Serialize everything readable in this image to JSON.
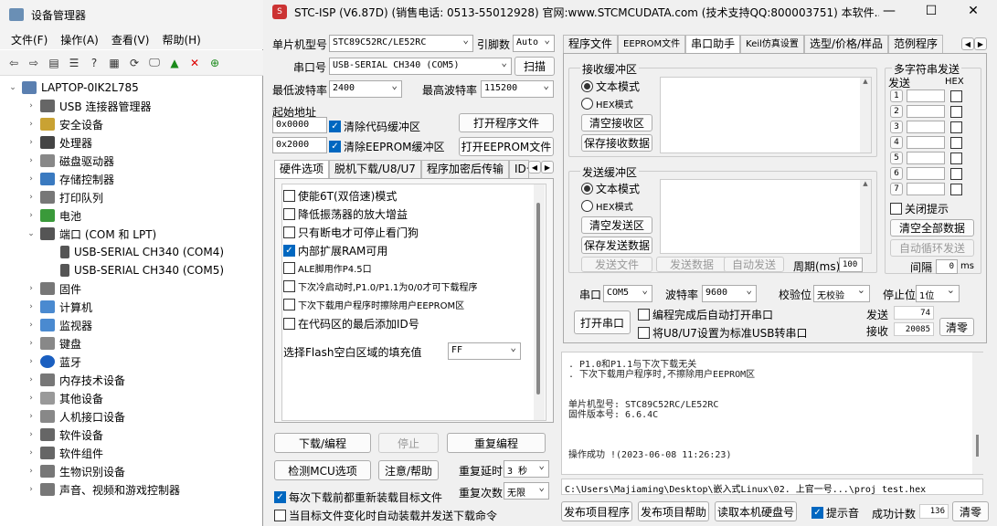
{
  "devmgr": {
    "title": "设备管理器",
    "menu": [
      "文件(F)",
      "操作(A)",
      "查看(V)",
      "帮助(H)"
    ],
    "root": "LAPTOP-0IK2L785",
    "items": [
      "USB 连接器管理器",
      "安全设备",
      "处理器",
      "磁盘驱动器",
      "存储控制器",
      "打印队列",
      "电池",
      "端口 (COM 和 LPT)",
      "USB-SERIAL CH340 (COM4)",
      "USB-SERIAL CH340 (COM5)",
      "固件",
      "计算机",
      "监视器",
      "键盘",
      "蓝牙",
      "内存技术设备",
      "其他设备",
      "人机接口设备",
      "软件设备",
      "软件组件",
      "生物识别设备",
      "声音、视频和游戏控制器"
    ]
  },
  "stc": {
    "title": "STC-ISP (V6.87D) (销售电话: 0513-55012928) 官网:www.STCMCUDATA.com  (技术支持QQ:800003751) 本软件...",
    "mcu_label": "单片机型号",
    "mcu": "STC89C52RC/LE52RC",
    "pins_label": "引脚数",
    "pins": "Auto",
    "port_label": "串口号",
    "port": "USB-SERIAL CH340 (COM5)",
    "scan": "扫描",
    "minbaud_label": "最低波特率",
    "minbaud": "2400",
    "maxbaud_label": "最高波特率",
    "maxbaud": "115200",
    "start_label": "起始地址",
    "addr1": "0x0000",
    "clr_code": "清除代码缓冲区",
    "open_prog": "打开程序文件",
    "addr2": "0x2000",
    "clr_eeprom": "清除EEPROM缓冲区",
    "open_eeprom": "打开EEPROM文件",
    "lefttabs": [
      "硬件选项",
      "脱机下载/U8/U7",
      "程序加密后传输",
      "ID号"
    ],
    "options": [
      {
        "label": "使能6T(双倍速)模式",
        "on": false
      },
      {
        "label": "降低振荡器的放大增益",
        "on": false
      },
      {
        "label": "只有断电才可停止看门狗",
        "on": false
      },
      {
        "label": "内部扩展RAM可用",
        "on": true
      },
      {
        "label": "ALE脚用作P4.5口",
        "on": false
      },
      {
        "label": "下次冷启动时,P1.0/P1.1为0/0才可下载程序",
        "on": false
      },
      {
        "label": "下次下载用户程序时擦除用户EEPROM区",
        "on": false
      },
      {
        "label": "在代码区的最后添加ID号",
        "on": false
      }
    ],
    "fill_label": "选择Flash空白区域的填充值",
    "fill": "FF",
    "download": "下载/编程",
    "stop": "停止",
    "reprog": "重复编程",
    "check_mcu": "检测MCU选项",
    "help": "注意/帮助",
    "delay_label": "重复延时",
    "delay": "3 秒",
    "count_label": "重复次数",
    "count": "无限",
    "reload": "每次下载前都重新装载目标文件",
    "autoload": "当目标文件变化时自动装载并发送下载命令",
    "righttabs": [
      "程序文件",
      "EEPROM文件",
      "串口助手",
      "Keil仿真设置",
      "选型/价格/样品",
      "范例程序"
    ],
    "recv_group": "接收缓冲区",
    "text_mode": "文本模式",
    "hex_mode": "HEX模式",
    "clear_recv": "清空接收区",
    "save_recv": "保存接收数据",
    "send_group": "发送缓冲区",
    "clear_send": "清空发送区",
    "save_send": "保存发送数据",
    "send_file": "发送文件",
    "send_data": "发送数据",
    "auto_send": "自动发送",
    "period_label": "周期(ms)",
    "period": "100",
    "multi_group": "多字符串发送",
    "send_col": "发送",
    "hex_col": "HEX",
    "rows": [
      "1",
      "2",
      "3",
      "4",
      "5",
      "6",
      "7"
    ],
    "close_hint": "关闭提示",
    "clear_all": "清空全部数据",
    "auto_loop": "自动循环发送",
    "interval_label": "间隔",
    "interval": "0",
    "ms": "ms",
    "com_label": "串口",
    "com": "COM5",
    "baud_label": "波特率",
    "baud": "9600",
    "parity_label": "校验位",
    "parity": "无校验",
    "stop_label": "停止位",
    "stopbits": "1位",
    "open_com": "打开串口",
    "auto_open": "编程完成后自动打开串口",
    "usb_cdc": "将U8/U7设置为标准USB转串口",
    "sent_label": "发送",
    "sent": "74",
    "recv_label": "接收",
    "recv": "20085",
    "clear": "清零",
    "log": ". P1.0和P1.1与下次下载无关\n. 下次下载用户程序时,不擦除用户EEPROM区\n\n\n单片机型号: STC89C52RC/LE52RC\n固件版本号: 6.6.4C\n\n\n\n操作成功 !(2023-06-08 11:26:23)",
    "path": "C:\\Users\\Majiaming\\Desktop\\嵌入式Linux\\02. 上官一号...\\proj_test.hex",
    "publish": "发布项目程序",
    "publish_help": "发布项目帮助",
    "read_disk": "读取本机硬盘号",
    "beep": "提示音",
    "success_label": "成功计数",
    "success": "136",
    "clear2": "清零"
  }
}
